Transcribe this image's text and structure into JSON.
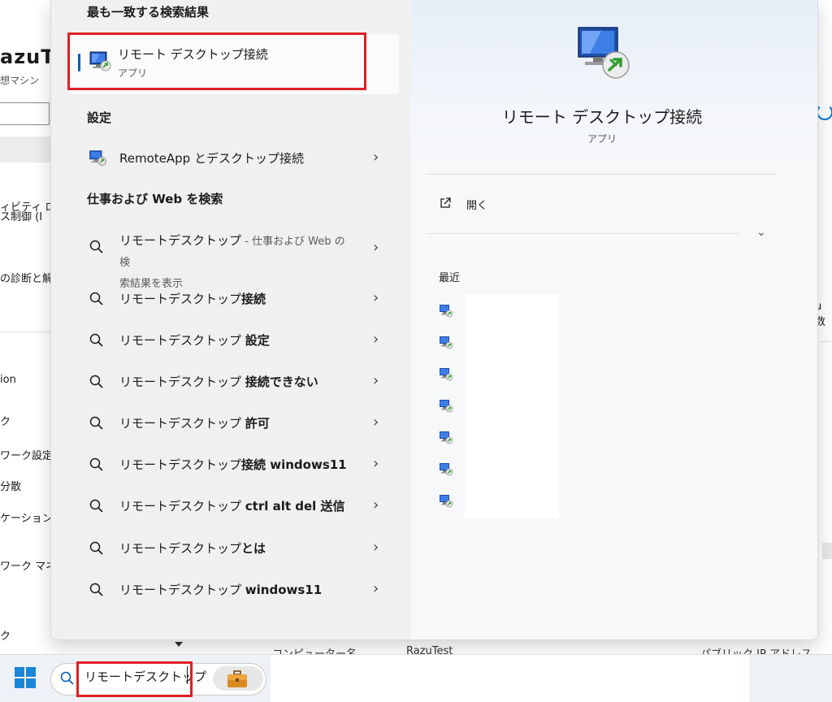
{
  "background": {
    "app_title": "azuT",
    "app_subtitle": "想マシン",
    "items": [
      {
        "label": "ィビティ ロ",
        "top": 0
      },
      {
        "label": "ス制御 (I",
        "top": 0
      },
      {
        "label": "の診断と解",
        "top": 0
      },
      {
        "label": "ion",
        "top": 0
      },
      {
        "label": "ク",
        "top": 0
      },
      {
        "label": "ワーク設定",
        "top": 0
      },
      {
        "label": "分散",
        "top": 0
      },
      {
        "label": "ケーションの",
        "top": 0
      },
      {
        "label": "ワーク マネ",
        "top": 0
      },
      {
        "label": "ク",
        "top": 0
      }
    ],
    "right_text": "u 数",
    "bottom_row": [
      "コンピューター名",
      "RazuTest",
      "パブリック IP アドレス"
    ]
  },
  "search": {
    "best_match_header": "最も一致する検索結果",
    "best_match": {
      "name": "リモート デスクトップ接続",
      "type": "アプリ"
    },
    "settings_header": "設定",
    "settings_items": [
      {
        "label": "RemoteApp とデスクトップ接続"
      }
    ],
    "web_header": "仕事および Web を検索",
    "web_first": {
      "prefix": "リモートデスクトップ",
      "suffix_line1": " - 仕事および Web の検",
      "suffix_line2": "索結果を表示"
    },
    "web_items": [
      {
        "prefix": "リモートデスクトップ",
        "bold": "接続"
      },
      {
        "prefix": "リモートデスクトップ ",
        "bold": "設定"
      },
      {
        "prefix": "リモートデスクトップ ",
        "bold": "接続できない"
      },
      {
        "prefix": "リモートデスクトップ ",
        "bold": "許可"
      },
      {
        "prefix": "リモートデスクトップ",
        "bold": "接続 windows11"
      },
      {
        "prefix": "リモートデスクトップ ",
        "bold": "ctrl alt del 送信"
      },
      {
        "prefix": "リモートデスクトップ",
        "bold": "とは"
      },
      {
        "prefix": "リモートデスクトップ ",
        "bold": "windows11"
      }
    ]
  },
  "details": {
    "app_name": "リモート デスクトップ接続",
    "app_type": "アプリ",
    "open_label": "開く",
    "recent_header": "最近",
    "recent_count": 7
  },
  "taskbar": {
    "search_query": "リモートデスクトップ"
  },
  "colors": {
    "accent": "#005fb8",
    "highlight_box": "#e01f26"
  }
}
